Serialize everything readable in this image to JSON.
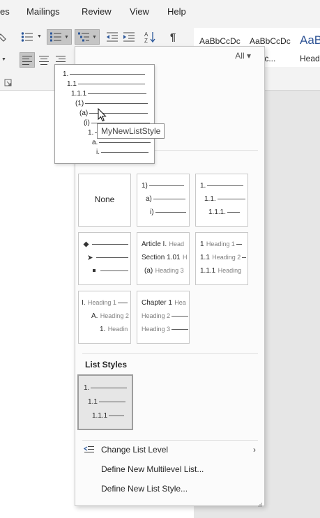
{
  "ribbon": {
    "tabs": [
      "es",
      "Mailings",
      "Review",
      "View",
      "Help"
    ],
    "styles": [
      {
        "sample": "AaBbCcDc",
        "name": ""
      },
      {
        "sample": "AaBbCcDc",
        "name": "Spac..."
      },
      {
        "sample": "AaB",
        "name": "Head"
      }
    ]
  },
  "gallery": {
    "filter_label": "All ▾",
    "list_library": {
      "none_label": "None",
      "cell2": [
        {
          "num": "1)"
        },
        {
          "num": "a)"
        },
        {
          "num": "i)"
        }
      ],
      "cell3": [
        {
          "num": "1."
        },
        {
          "num": "1.1."
        },
        {
          "num": "1.1.1."
        }
      ],
      "cell5": [
        {
          "num": "Article I.",
          "text": "Head"
        },
        {
          "num": "Section 1.01",
          "text": "H"
        },
        {
          "num": "(a)",
          "text": "Heading 3"
        }
      ],
      "cell6": [
        {
          "num": "1",
          "text": "Heading 1"
        },
        {
          "num": "1.1",
          "text": "Heading 2"
        },
        {
          "num": "1.1.1",
          "text": "Heading"
        }
      ],
      "cell7": [
        {
          "num": "I.",
          "text": "Heading 1"
        },
        {
          "num": "A.",
          "text": "Heading 2"
        },
        {
          "num": "1.",
          "text": "Headin"
        }
      ],
      "cell8": [
        {
          "num": "Chapter 1",
          "text": "Hea"
        },
        {
          "num": "",
          "text": "Heading 2"
        },
        {
          "num": "",
          "text": "Heading 3"
        }
      ]
    },
    "list_styles": {
      "heading": "List Styles",
      "item1": [
        "1.",
        "1.1",
        "1.1.1"
      ]
    },
    "commands": {
      "change_level": "Change List Level",
      "define_multilevel": "Define New Multilevel List...",
      "define_style": "Define New List Style..."
    }
  },
  "preview": {
    "levels": [
      "1.",
      "1.1",
      "1.1.1",
      "(1)",
      "(a)",
      "(i)",
      "1.",
      "a.",
      "i."
    ],
    "tooltip": "MyNewListStyle"
  },
  "colors": {
    "accent": "#2b579a",
    "pressed": "#c5c5c5",
    "selected_border": "#9d9d9d"
  }
}
